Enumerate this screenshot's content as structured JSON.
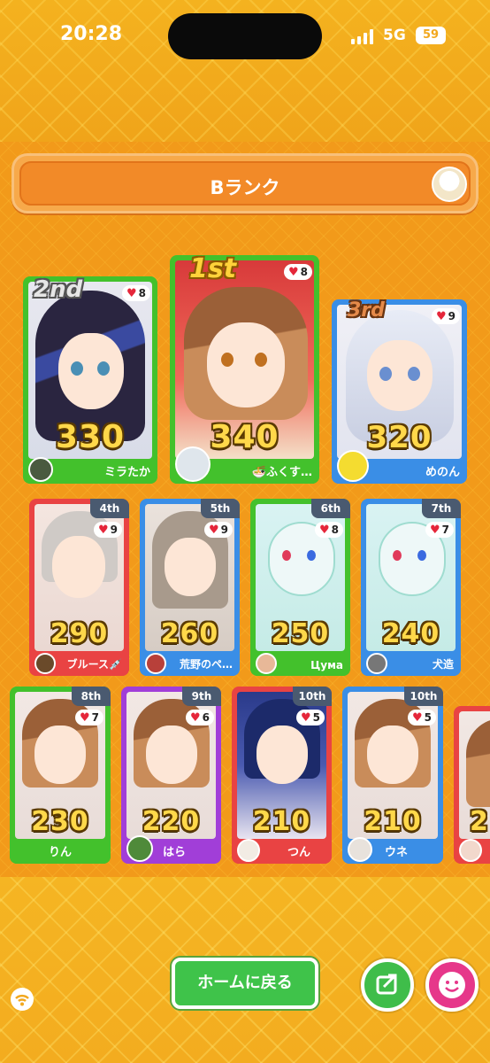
{
  "status_bar": {
    "time": "20:28",
    "network": "5G",
    "battery": "59"
  },
  "header": {
    "title": "Bランク"
  },
  "podium": [
    {
      "place": "2nd",
      "likes": "8",
      "score": "330",
      "name": "ミラたか"
    },
    {
      "place": "1st",
      "likes": "8",
      "score": "340",
      "name": "🍜ふくす…"
    },
    {
      "place": "3rd",
      "likes": "9",
      "score": "320",
      "name": "めのん"
    }
  ],
  "row2": [
    {
      "rank": "4th",
      "likes": "9",
      "score": "290",
      "name": "ブルース💉"
    },
    {
      "rank": "5th",
      "likes": "9",
      "score": "260",
      "name": "荒野のペ…"
    },
    {
      "rank": "6th",
      "likes": "8",
      "score": "250",
      "name": "Цума"
    },
    {
      "rank": "7th",
      "likes": "7",
      "score": "240",
      "name": "犬造"
    }
  ],
  "row3": [
    {
      "rank": "8th",
      "likes": "7",
      "score": "230",
      "name": "りん"
    },
    {
      "rank": "9th",
      "likes": "6",
      "score": "220",
      "name": "はら"
    },
    {
      "rank": "10th",
      "likes": "5",
      "score": "210",
      "name": "つん"
    },
    {
      "rank": "10th",
      "likes": "5",
      "score": "210",
      "name": "ウネ"
    },
    {
      "rank": "",
      "likes": "",
      "score": "2",
      "name": ""
    }
  ],
  "footer": {
    "home_button": "ホームに戻る"
  },
  "icons": [
    "signal-icon",
    "battery-icon",
    "heart-icon",
    "share-icon",
    "smile-icon",
    "wifi-icon"
  ]
}
